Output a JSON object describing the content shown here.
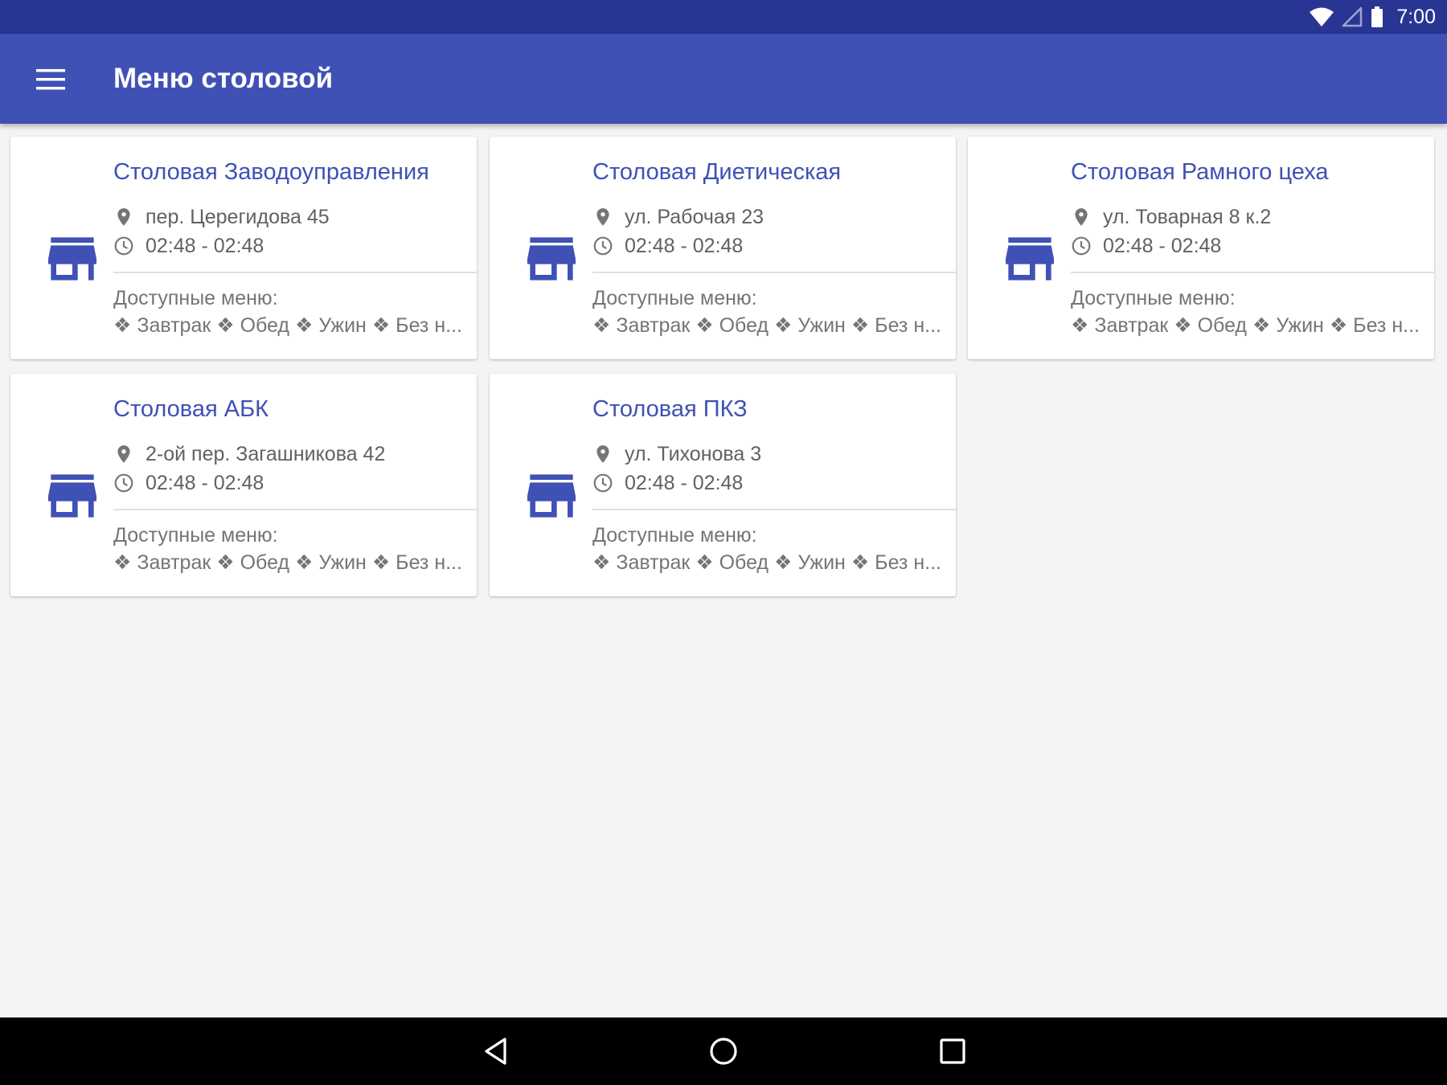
{
  "status_bar": {
    "time": "7:00",
    "icons": [
      "wifi-icon",
      "signal-icon",
      "battery-icon"
    ]
  },
  "toolbar": {
    "title": "Меню столовой",
    "menu_icon": "hamburger-menu-icon"
  },
  "colors": {
    "status_bar": "#283593",
    "primary": "#3f51b5",
    "background": "#f4f4f4",
    "card": "#ffffff",
    "secondary_text": "#616161",
    "nav_bar": "#000000"
  },
  "canteens": [
    {
      "name": "Столовая Заводоуправления",
      "address": "пер. Церегидова 45",
      "hours": "02:48 - 02:48",
      "menus_label": "Доступные меню:",
      "menus": "❖ Завтрак ❖ Обед ❖ Ужин ❖ Без н..."
    },
    {
      "name": "Столовая Диетическая",
      "address": "ул. Рабочая 23",
      "hours": "02:48 - 02:48",
      "menus_label": "Доступные меню:",
      "menus": "❖ Завтрак ❖ Обед ❖ Ужин ❖ Без н..."
    },
    {
      "name": "Столовая Рамного цеха",
      "address": "ул. Товарная 8 к.2",
      "hours": "02:48 - 02:48",
      "menus_label": "Доступные меню:",
      "menus": "❖ Завтрак ❖ Обед ❖ Ужин ❖ Без н..."
    },
    {
      "name": "Столовая АБК",
      "address": "2-ой пер. Загашникова 42",
      "hours": "02:48 - 02:48",
      "menus_label": "Доступные меню:",
      "menus": "❖ Завтрак ❖ Обед ❖ Ужин ❖ Без н..."
    },
    {
      "name": "Столовая ПКЗ",
      "address": "ул. Тихонова 3",
      "hours": "02:48 - 02:48",
      "menus_label": "Доступные меню:",
      "menus": "❖ Завтрак ❖ Обед ❖ Ужин ❖ Без н..."
    }
  ],
  "nav_bar": {
    "buttons": [
      "back-icon",
      "home-icon",
      "recents-icon"
    ]
  }
}
